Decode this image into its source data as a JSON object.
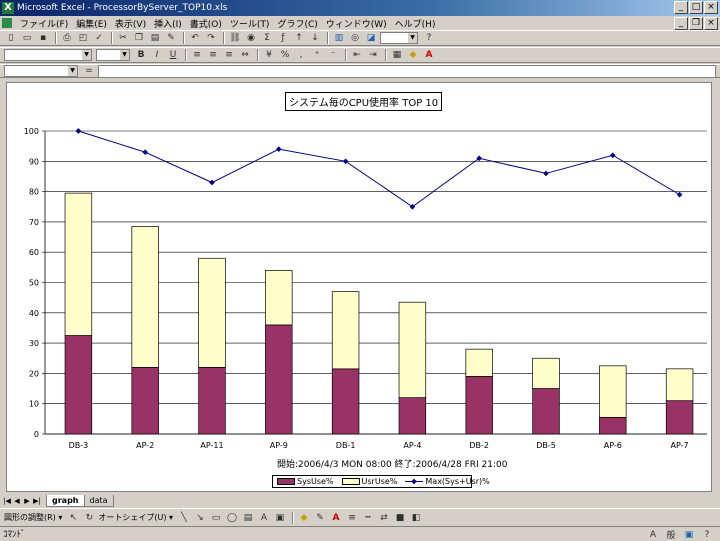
{
  "window": {
    "title": "Microsoft Excel - ProcessorByServer_TOP10.xls",
    "app_glyph": "X"
  },
  "menu": [
    "ファイル(F)",
    "編集(E)",
    "表示(V)",
    "挿入(I)",
    "書式(O)",
    "ツール(T)",
    "グラフ(C)",
    "ウィンドウ(W)",
    "ヘルプ(H)"
  ],
  "sheet_tabs": [
    "graph",
    "data"
  ],
  "drawing_toolbar": {
    "draw_label": "図形の調整(R) ▾",
    "autoshape_label": "オートシェイプ(U) ▾"
  },
  "status": {
    "text": "ｺﾏﾝﾄﾞ"
  },
  "chart_data": {
    "type": "bar",
    "title": "システム毎のCPU使用率 TOP 10",
    "subtitle": "開始:2006/4/3 MON 08:00 終了:2006/4/28 FRI 21:00",
    "categories": [
      "DB-3",
      "AP-2",
      "AP-11",
      "AP-9",
      "DB-1",
      "AP-4",
      "DB-2",
      "DB-5",
      "AP-6",
      "AP-7"
    ],
    "series": [
      {
        "name": "SysUse%",
        "type": "bar",
        "stack": true,
        "color": "#993366",
        "values": [
          32.5,
          22,
          22,
          36,
          21.5,
          12,
          19,
          15,
          5.5,
          11
        ]
      },
      {
        "name": "UsrUse%",
        "type": "bar",
        "stack": true,
        "color": "#ffffcc",
        "values": [
          47,
          46.5,
          36,
          18,
          25.5,
          31.5,
          9,
          10,
          17,
          10.5
        ]
      },
      {
        "name": "Max(Sys+Usr)%",
        "type": "line",
        "color": "#000080",
        "values": [
          100,
          93,
          83,
          94,
          90,
          75,
          91,
          86,
          92,
          79
        ]
      }
    ],
    "ylim": [
      0,
      100
    ],
    "yticks": [
      "0",
      "10",
      "20",
      "30",
      "40",
      "50",
      "60",
      "70",
      "80",
      "90",
      "100"
    ],
    "grid": true,
    "legend_position": "bottom"
  }
}
